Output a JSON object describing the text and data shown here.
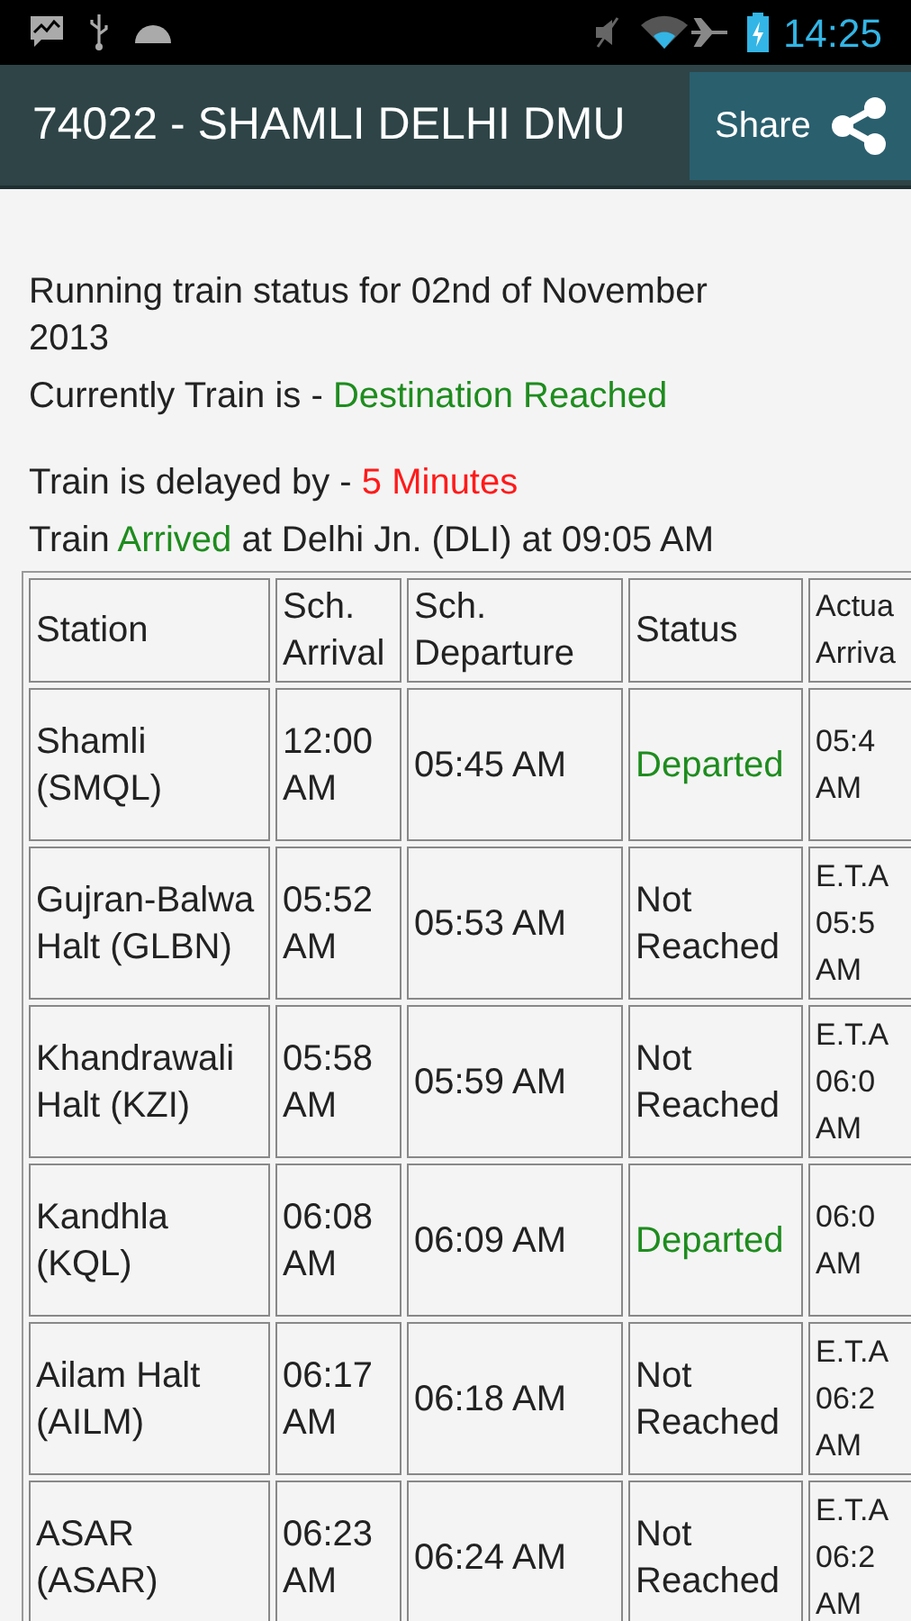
{
  "status_bar": {
    "time": "14:25"
  },
  "action_bar": {
    "title": "74022 - SHAMLI DELHI DMU",
    "share_button": "Share"
  },
  "info_blocks": [
    [
      {
        "parts": [
          {
            "text": "Running train status for 02nd of November 2013",
            "color": "#222222"
          }
        ]
      },
      {
        "parts": [
          {
            "text": "Currently Train is - ",
            "color": "#222222"
          },
          {
            "text": "Destination Reached",
            "color": "#1e8c1e"
          }
        ]
      }
    ],
    [
      {
        "parts": [
          {
            "text": "Train is delayed by - ",
            "color": "#222222"
          },
          {
            "text": "5 Minutes",
            "color": "#ff1a1a"
          }
        ]
      },
      {
        "parts": [
          {
            "text": "Train ",
            "color": "#222222"
          },
          {
            "text": "Arrived",
            "color": "#1e8c1e"
          },
          {
            "text": " at Delhi Jn. (DLI) at 09:05 AM",
            "color": "#222222"
          }
        ]
      }
    ]
  ],
  "table": {
    "columns": [
      "Station",
      "Sch. Arrival",
      "Sch. Departure",
      "Status",
      "Actua Arriva"
    ],
    "rows": [
      {
        "station": "Shamli (SMQL)",
        "sch_arrival": "12:00 AM",
        "sch_departure": "05:45 AM",
        "status": "Departed",
        "departed": true,
        "actual_arrival": "05:4 AM"
      },
      {
        "station": "Gujran-Balwa Halt (GLBN)",
        "sch_arrival": "05:52 AM",
        "sch_departure": "05:53 AM",
        "status": "Not Reached",
        "departed": false,
        "actual_arrival": "E.T.A 05:5 AM"
      },
      {
        "station": "Khandrawali Halt (KZI)",
        "sch_arrival": "05:58 AM",
        "sch_departure": "05:59 AM",
        "status": "Not Reached",
        "departed": false,
        "actual_arrival": "E.T.A 06:0 AM"
      },
      {
        "station": "Kandhla (KQL)",
        "sch_arrival": "06:08 AM",
        "sch_departure": "06:09 AM",
        "status": "Departed",
        "departed": true,
        "actual_arrival": "06:0 AM"
      },
      {
        "station": "Ailam Halt (AILM)",
        "sch_arrival": "06:17 AM",
        "sch_departure": "06:18 AM",
        "status": "Not Reached",
        "departed": false,
        "actual_arrival": "E.T.A 06:2 AM"
      },
      {
        "station": "ASAR (ASAR)",
        "sch_arrival": "06:23 AM",
        "sch_departure": "06:24 AM",
        "status": "Not Reached",
        "departed": false,
        "actual_arrival": "E.T.A 06:2 AM"
      }
    ]
  }
}
